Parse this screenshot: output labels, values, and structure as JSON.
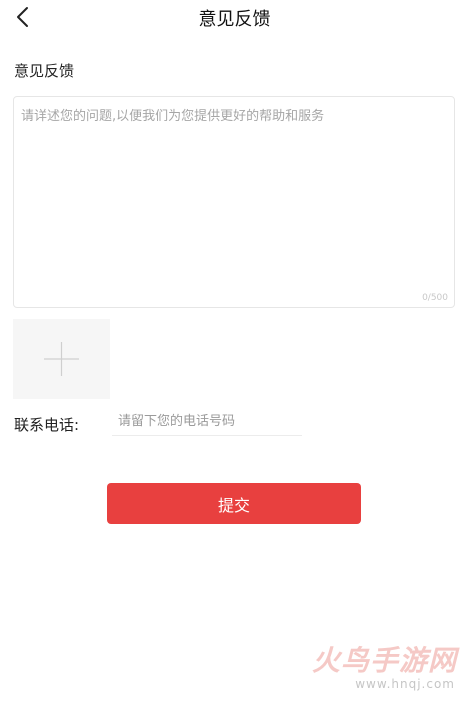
{
  "header": {
    "title": "意见反馈",
    "back_icon": "chevron-left-icon"
  },
  "feedback": {
    "label": "意见反馈",
    "placeholder": "请详述您的问题,以便我们为您提供更好的帮助和服务",
    "value": "",
    "counter": "0/500"
  },
  "upload": {
    "icon": "plus-icon"
  },
  "contact": {
    "label": "联系电话:",
    "placeholder": "请留下您的电话号码",
    "value": ""
  },
  "submit": {
    "label": "提交",
    "color": "#e8403f"
  },
  "watermark": {
    "logo_text": "火鸟手游网",
    "url": "www.hnqj.com"
  }
}
